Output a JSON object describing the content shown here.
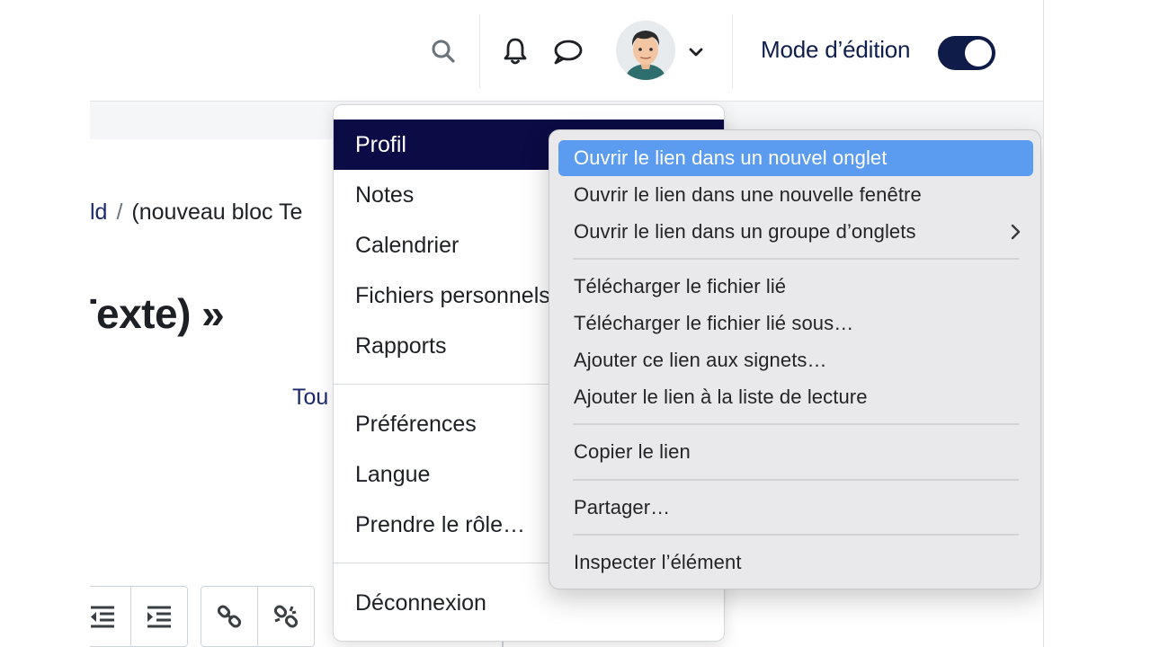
{
  "header": {
    "edit_mode_label": "Mode d’édition",
    "edit_mode_on": true
  },
  "page": {
    "breadcrumb_link": "ld",
    "breadcrumb_separator": "/",
    "breadcrumb_current": "(nouveau bloc Te",
    "heading": "exte) »",
    "heading_prefix_partial": "T",
    "side_link": "Tou"
  },
  "user_menu": {
    "items": [
      {
        "label": "Profil"
      },
      {
        "label": "Notes"
      },
      {
        "label": "Calendrier"
      },
      {
        "label": "Fichiers personnels"
      },
      {
        "label": "Rapports"
      },
      {
        "label": "Préférences"
      },
      {
        "label": "Langue"
      },
      {
        "label": "Prendre le rôle…"
      },
      {
        "label": "Déconnexion"
      }
    ]
  },
  "context_menu": {
    "items": [
      {
        "label": "Ouvrir le lien dans un nouvel onglet"
      },
      {
        "label": "Ouvrir le lien dans une nouvelle fenêtre"
      },
      {
        "label": "Ouvrir le lien dans un groupe d’onglets"
      },
      {
        "label": "Télécharger le fichier lié"
      },
      {
        "label": "Télécharger le fichier lié sous…"
      },
      {
        "label": "Ajouter ce lien aux signets…"
      },
      {
        "label": "Ajouter le lien à la liste de lecture"
      },
      {
        "label": "Copier le lien"
      },
      {
        "label": "Partager…"
      },
      {
        "label": "Inspecter l’élément"
      }
    ]
  },
  "colors": {
    "brand_navy": "#0b0b45",
    "toggle_on": "#0f1b48",
    "context_highlight": "#5c9cf0"
  }
}
